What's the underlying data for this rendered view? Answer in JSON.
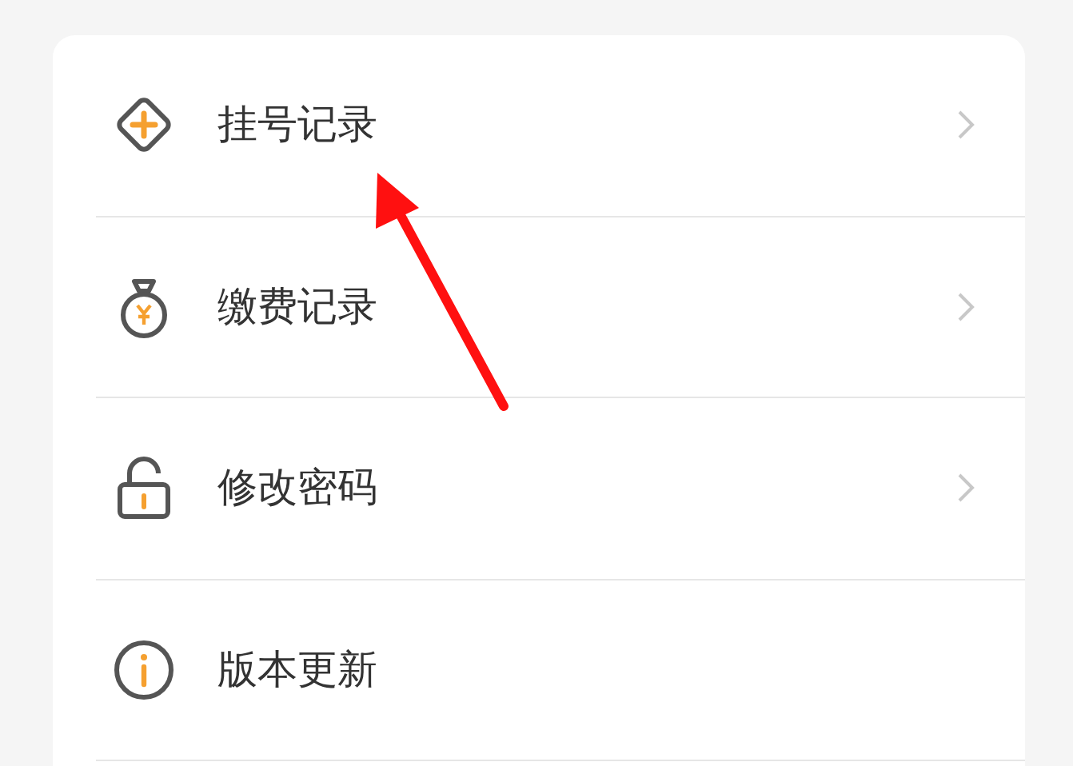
{
  "menu": [
    {
      "kind": "register",
      "label": "挂号记录",
      "chevron": true
    },
    {
      "kind": "payment",
      "label": "缴费记录",
      "chevron": true
    },
    {
      "kind": "password",
      "label": "修改密码",
      "chevron": true
    },
    {
      "kind": "update",
      "label": "版本更新",
      "chevron": false
    }
  ]
}
